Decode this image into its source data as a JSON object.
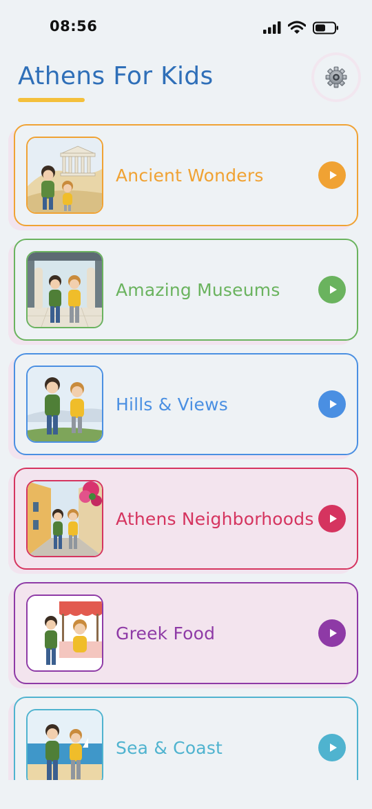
{
  "status_bar": {
    "time": "08:56"
  },
  "header": {
    "title": "Athens For Kids",
    "settings_icon": "gear-icon"
  },
  "categories": [
    {
      "label": "Ancient Wonders",
      "color": "#f0a233",
      "bg": "#eef2f5",
      "icon": "play-icon"
    },
    {
      "label": "Amazing Museums",
      "color": "#6ab35e",
      "bg": "#eef2f5",
      "icon": "play-icon"
    },
    {
      "label": "Hills & Views",
      "color": "#4a8fe2",
      "bg": "#eef2f5",
      "icon": "play-icon"
    },
    {
      "label": "Athens Neighborhoods",
      "color": "#d5345f",
      "bg": "#f3e4ee",
      "icon": "play-icon"
    },
    {
      "label": "Greek Food",
      "color": "#8e3aa6",
      "bg": "#f3e4ee",
      "icon": "play-icon"
    },
    {
      "label": "Sea & Coast",
      "color": "#4fb3cf",
      "bg": "#eef2f5",
      "icon": "play-icon"
    }
  ]
}
